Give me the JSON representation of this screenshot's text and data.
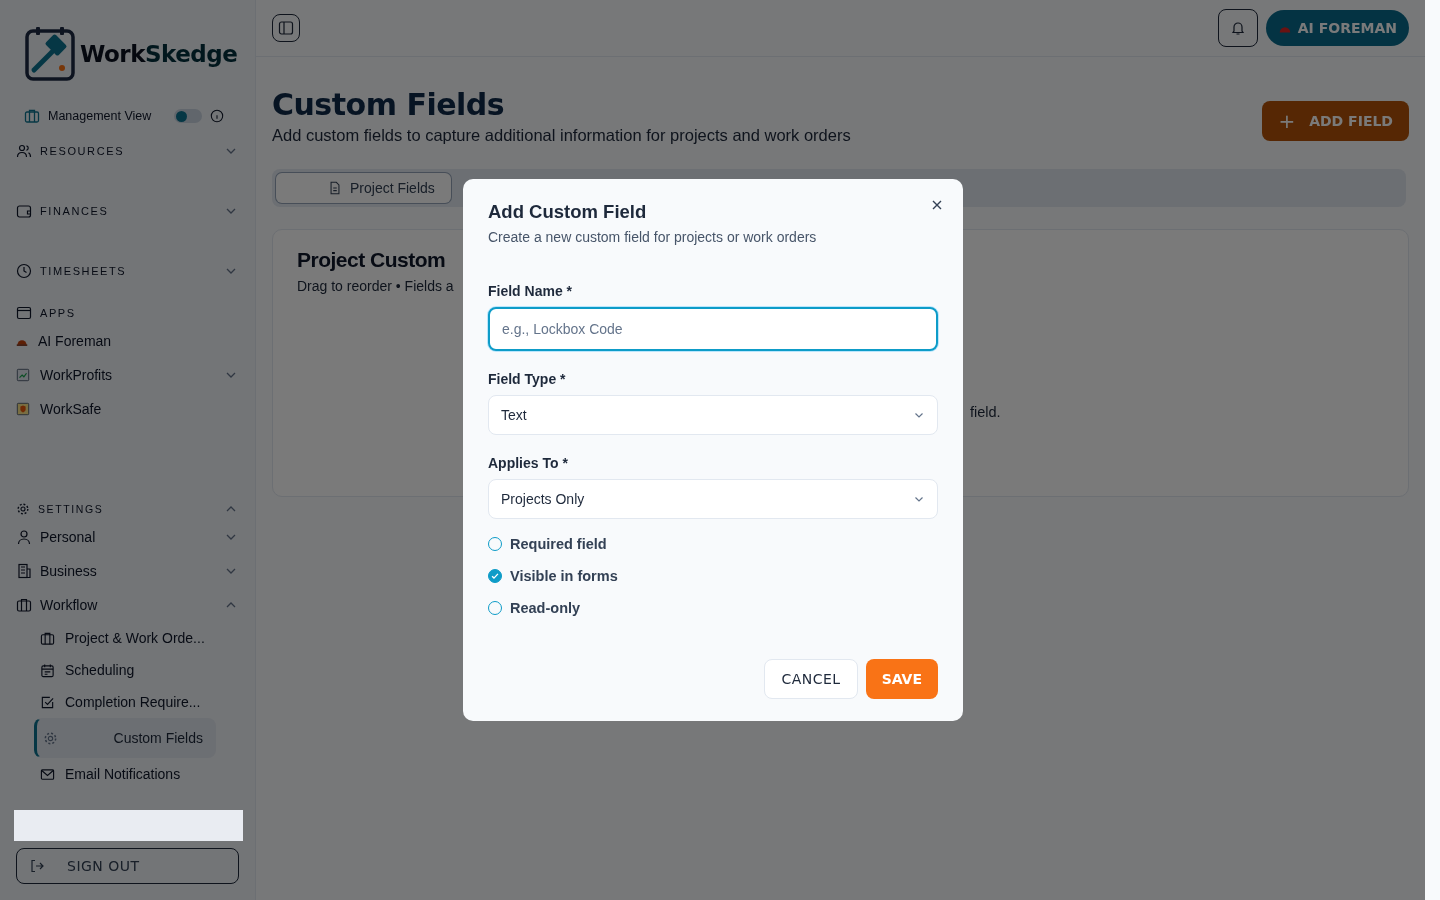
{
  "sidebar": {
    "logo": {
      "part1": "Work",
      "part2": "Skedge"
    },
    "management_view": {
      "label": "Management View",
      "on": false
    },
    "groups": [
      {
        "label": "RESOURCES",
        "expanded": false
      },
      {
        "label": "FINANCES",
        "expanded": false
      },
      {
        "label": "TIMESHEETS",
        "expanded": false
      }
    ],
    "apps": {
      "label": "APPS",
      "items": [
        {
          "label": "AI Foreman",
          "kind": "link"
        },
        {
          "label": "WorkProfits",
          "kind": "menu",
          "expanded": false
        },
        {
          "label": "WorkSafe",
          "kind": "link"
        }
      ]
    },
    "settings": {
      "label": "SETTINGS",
      "expanded": true,
      "items": [
        {
          "label": "Personal",
          "expanded": false
        },
        {
          "label": "Business",
          "expanded": false
        },
        {
          "label": "Workflow",
          "expanded": true,
          "children": [
            {
              "label": "Project & Work Orde...",
              "selected": false
            },
            {
              "label": "Scheduling",
              "selected": false
            },
            {
              "label": "Completion Require...",
              "selected": false
            },
            {
              "label": "Custom Fields",
              "selected": true
            },
            {
              "label": "Email Notifications",
              "selected": false
            }
          ]
        }
      ]
    },
    "sign_out": "SIGN OUT"
  },
  "topbar": {
    "ai_button": "AI FOREMAN"
  },
  "page": {
    "title": "Custom Fields",
    "subtitle": "Add custom fields to capture additional information for projects and work orders",
    "add_button": "ADD FIELD",
    "add_icon": "+",
    "tabs": [
      {
        "label": "Project Fields",
        "selected": true
      }
    ],
    "card": {
      "title": "Project Custom",
      "subtitle": "Drag to reorder • Fields a",
      "empty_text": "field."
    }
  },
  "dialog": {
    "title": "Add Custom Field",
    "subtitle": "Create a new custom field for projects or work orders",
    "field_name": {
      "label": "Field Name *",
      "placeholder": "e.g., Lockbox Code"
    },
    "field_type": {
      "label": "Field Type *",
      "value": "Text"
    },
    "applies_to": {
      "label": "Applies To *",
      "value": "Projects Only"
    },
    "options": [
      {
        "label": "Required field",
        "checked": false
      },
      {
        "label": "Visible in forms",
        "checked": true
      },
      {
        "label": "Read-only",
        "checked": false
      }
    ],
    "cancel": "CANCEL",
    "save": "SAVE"
  }
}
